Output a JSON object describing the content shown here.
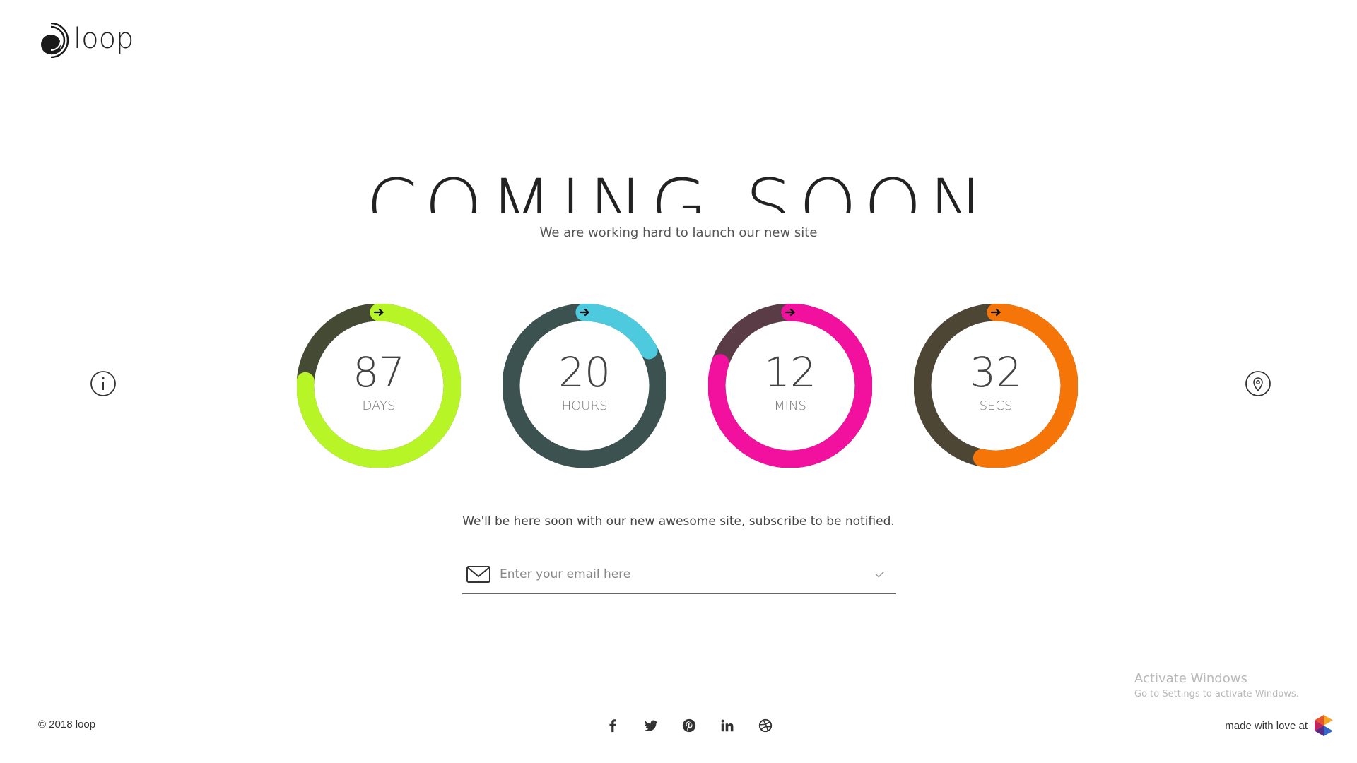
{
  "brand": {
    "name": "loop"
  },
  "hero": {
    "title": "COMING SOON",
    "tagline": "We are working hard to launch our new site"
  },
  "countdown": [
    {
      "value": "87",
      "unit": "DAYS",
      "progress": 0.76,
      "track_color": "#454a34",
      "fill_color": "#b8f526",
      "arrow_bg": "#b8f526"
    },
    {
      "value": "20",
      "unit": "HOURS",
      "progress": 0.17,
      "track_color": "#3c5250",
      "fill_color": "#4dcadd",
      "arrow_bg": "#4dcadd"
    },
    {
      "value": "12",
      "unit": "MINS",
      "progress": 0.8,
      "track_color": "#5a3c46",
      "fill_color": "#f2109e",
      "arrow_bg": "#f2109e"
    },
    {
      "value": "32",
      "unit": "SECS",
      "progress": 0.53,
      "track_color": "#4d4635",
      "fill_color": "#f57508",
      "arrow_bg": "#f57508"
    }
  ],
  "side_icons": {
    "left": "info-icon",
    "right": "location-pin-icon"
  },
  "subscribe": {
    "text": "We'll be here soon with our new awesome site, subscribe to be notified.",
    "placeholder": "Enter your email here",
    "value": ""
  },
  "footer": {
    "copyright": "© 2018 loop",
    "socials": [
      "facebook-icon",
      "twitter-icon",
      "pinterest-icon",
      "linkedin-icon",
      "dribbble-icon"
    ],
    "made_with": "made with love at"
  },
  "watermark": {
    "title": "Activate Windows",
    "subtitle": "Go to Settings to activate Windows."
  }
}
